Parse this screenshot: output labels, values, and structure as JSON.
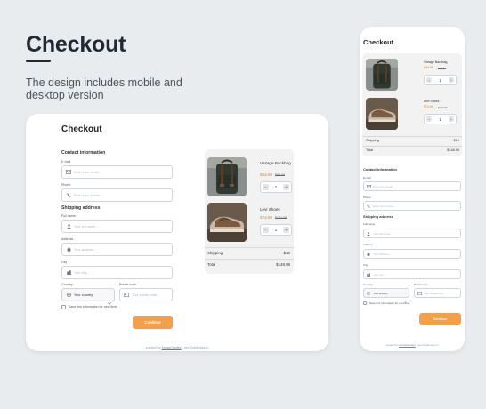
{
  "hero": {
    "title": "Checkout",
    "description": "The design includes mobile and desktop version"
  },
  "checkout": {
    "title": "Checkout",
    "contact_section": "Contact information",
    "email_label": "E-mail",
    "email_placeholder": "Enter your email...",
    "phone_label": "Phone",
    "phone_placeholder": "Enter your phone...",
    "shipping_section": "Shipping address",
    "fullname_label": "Full name",
    "fullname_placeholder": "Your full name...",
    "address_label": "Address",
    "address_placeholder": "Your address...",
    "city_label": "City",
    "city_placeholder": "Your city...",
    "country_label": "Country",
    "country_value": "Your country",
    "postal_label": "Postal code",
    "postal_placeholder": "Your postal code...",
    "save_label": "Save this information for next time",
    "continue_label": "Continue"
  },
  "cart": {
    "items": [
      {
        "name": "Vintage Backbag",
        "price": "$54.99",
        "old_price": "$94.99",
        "qty": "1"
      },
      {
        "name": "Levi Shoes",
        "price": "$74.99",
        "old_price": "$124.99",
        "qty": "1"
      }
    ],
    "shipping_label": "Shipping",
    "shipping_value": "$19",
    "total_label": "Total",
    "total_value": "$148.98",
    "minus": "−",
    "plus": "+"
  },
  "footer": {
    "prefix": "created by ",
    "author": "JonasGuedes",
    "suffix": " - devChallenges.io"
  },
  "icons": {
    "email": "mail-icon",
    "phone": "phone-icon",
    "fullname": "user-icon",
    "address": "home-icon",
    "city": "city-icon",
    "country": "globe-icon",
    "postal": "postal-icon",
    "chevron": "chevron-down-icon"
  },
  "colors": {
    "accent": "#f4a04b",
    "price": "#f0a045",
    "background": "#e9ecee"
  }
}
